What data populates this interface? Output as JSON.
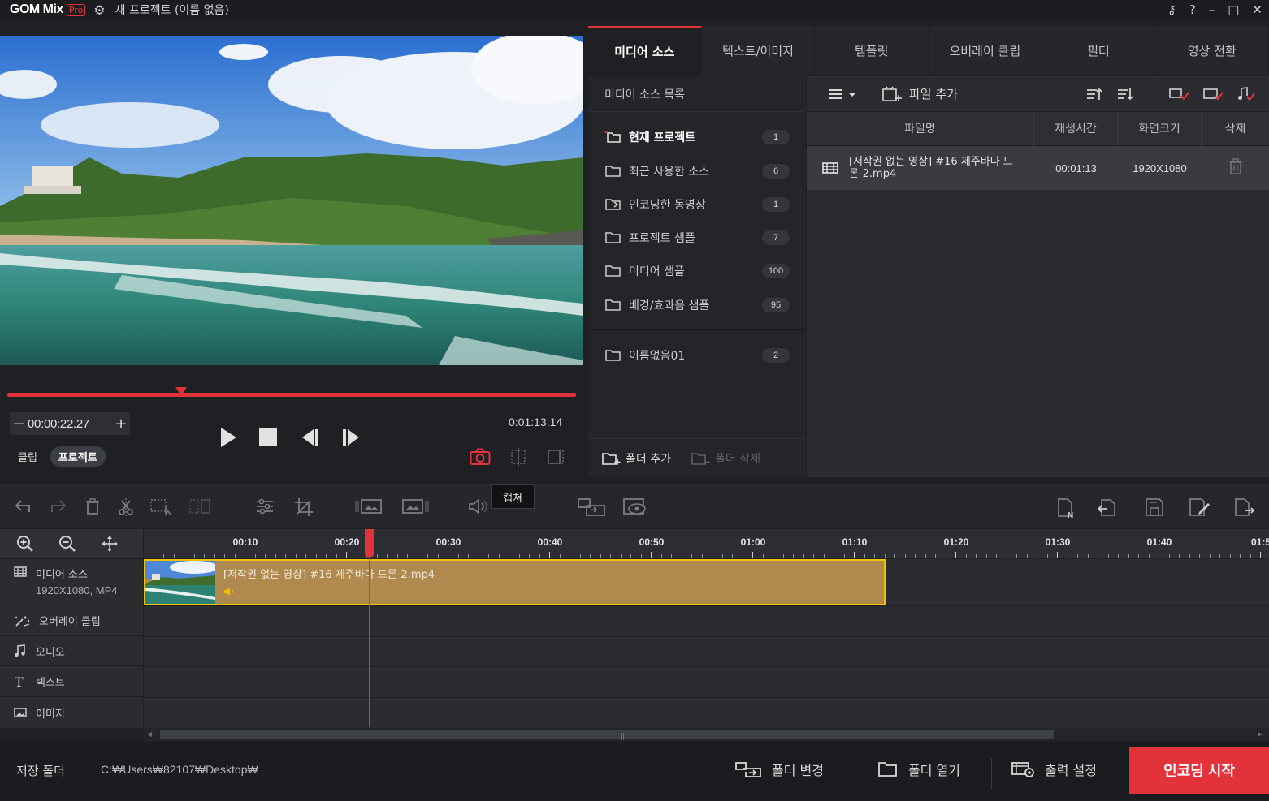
{
  "app": {
    "logo": "GOM Mix",
    "logo_badge": "Pro",
    "title": "새 프로젝트 (이름 없음)"
  },
  "window_controls": {
    "help": "?",
    "minimize": "–",
    "maximize": "□",
    "close": "✕"
  },
  "preview": {
    "current_time": "00:00:22.27",
    "total_time": "0:01:13.14",
    "progress": 0.305,
    "mode_tabs": [
      {
        "label": "클립",
        "active": false
      },
      {
        "label": "프로젝트",
        "active": true
      }
    ]
  },
  "tabs": [
    {
      "label": "미디어 소스",
      "active": true
    },
    {
      "label": "텍스트/이미지",
      "active": false
    },
    {
      "label": "템플릿",
      "active": false
    },
    {
      "label": "오버레이 클립",
      "active": false
    },
    {
      "label": "필터",
      "active": false
    },
    {
      "label": "영상 전환",
      "active": false
    }
  ],
  "source_list": {
    "title": "미디어 소스 목록",
    "items": [
      {
        "label": "현재 프로젝트",
        "count": "1",
        "active": true
      },
      {
        "label": "최근 사용한 소스",
        "count": "6",
        "active": false
      },
      {
        "label": "인코딩한 동영상",
        "count": "1",
        "active": false
      },
      {
        "label": "프로젝트 샘플",
        "count": "7",
        "active": false
      },
      {
        "label": "미디어 샘플",
        "count": "100",
        "active": false
      },
      {
        "label": "배경/효과음 샘플",
        "count": "95",
        "active": false
      },
      {
        "label": "이름없음01",
        "count": "2",
        "active": false
      }
    ],
    "add_folder": "폴더 추가",
    "delete_folder": "폴더 삭제"
  },
  "file_panel": {
    "add_file": "파일 추가",
    "columns": [
      "파일명",
      "재생시간",
      "화면크기",
      "삭제"
    ],
    "rows": [
      {
        "name_line1": "[저작권 없는 영상] #16 제주바다 드",
        "name_line2": "론-2.mp4",
        "duration": "00:01:13",
        "size": "1920X1080"
      }
    ]
  },
  "timeline": {
    "tooltip": "캡쳐",
    "ruler_labels": [
      "00:10",
      "00:20",
      "00:30",
      "00:40",
      "00:50",
      "01:00",
      "01:10",
      "01:20",
      "01:30",
      "01:40",
      "01:5"
    ],
    "tracks": [
      {
        "label": "미디어 소스",
        "sub": "1920X1080, MP4"
      },
      {
        "label": "오버레이 클립",
        "sub": ""
      },
      {
        "label": "오디오",
        "sub": ""
      },
      {
        "label": "텍스트",
        "sub": ""
      },
      {
        "label": "이미지",
        "sub": ""
      }
    ],
    "clip_name": "[저작권 없는 영상] #16 제주바다 드론-2.mp4",
    "playhead_seconds": 22.27
  },
  "footer": {
    "save_folder_label": "저장 폴더",
    "save_path": "C:₩Users₩82107₩Desktop₩",
    "change_folder": "폴더 변경",
    "open_folder": "폴더 열기",
    "output_settings": "출력 설정",
    "start_encoding": "인코딩 시작"
  },
  "colors": {
    "accent": "#e2323a",
    "clip_fill": "#b0894f",
    "clip_border": "#f2c200",
    "background": "#1f2024"
  }
}
